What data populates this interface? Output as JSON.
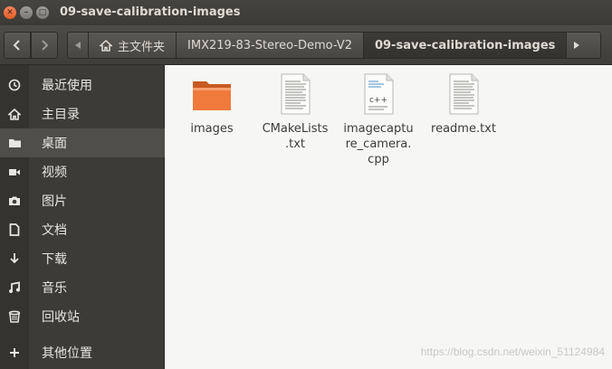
{
  "window": {
    "title": "09-save-calibration-images"
  },
  "toolbar": {
    "back_icon": "chevron-left-icon",
    "forward_icon": "chevron-right-icon",
    "breadcrumbs": [
      {
        "label": "主文件夹",
        "icon": "home-icon"
      },
      {
        "label": "IMX219-83-Stereo-Demo-V2"
      },
      {
        "label": "09-save-calibration-images"
      }
    ]
  },
  "sidebar": {
    "items": [
      {
        "label": "最近使用",
        "icon": "clock-icon"
      },
      {
        "label": "主目录",
        "icon": "home-icon"
      },
      {
        "label": "桌面",
        "icon": "folder-icon"
      },
      {
        "label": "视频",
        "icon": "video-icon"
      },
      {
        "label": "图片",
        "icon": "camera-icon"
      },
      {
        "label": "文档",
        "icon": "document-icon"
      },
      {
        "label": "下载",
        "icon": "download-icon"
      },
      {
        "label": "音乐",
        "icon": "music-icon"
      },
      {
        "label": "回收站",
        "icon": "trash-icon"
      },
      {
        "label": "其他位置",
        "icon": "plus-icon"
      }
    ],
    "active_index": 2
  },
  "files": [
    {
      "name": "images",
      "type": "folder"
    },
    {
      "name": "CMakeLists\n.txt",
      "type": "text"
    },
    {
      "name": "imagecaptu\nre_camera.\ncpp",
      "type": "cpp"
    },
    {
      "name": "readme.txt",
      "type": "text"
    }
  ],
  "watermark": "https://blog.csdn.net/weixin_51124984",
  "colors": {
    "folder": "#f07a3c",
    "active_bg": "#4f4e49",
    "sidebar_bg": "#3c3b37"
  }
}
